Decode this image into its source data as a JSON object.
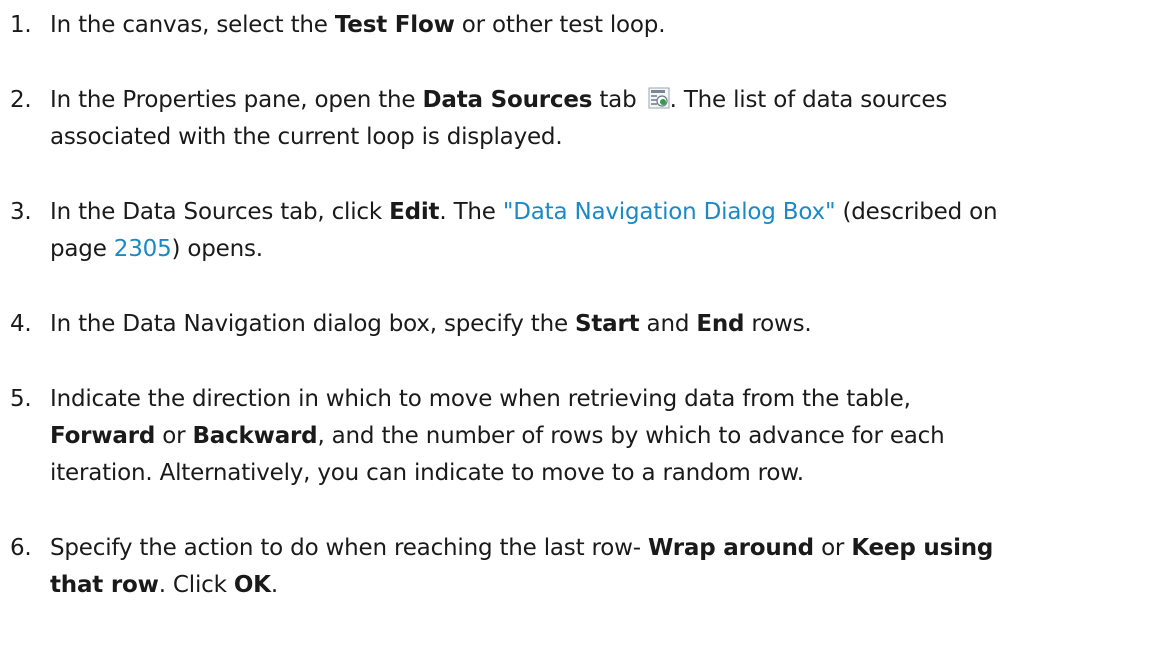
{
  "steps": [
    {
      "num": "1.",
      "parts": [
        {
          "t": "In the canvas, select the "
        },
        {
          "b": "Test Flow"
        },
        {
          "t": " or other test loop."
        }
      ]
    },
    {
      "num": "2.",
      "line1": [
        {
          "t": "In the Properties pane, open the "
        },
        {
          "b": "Data Sources"
        },
        {
          "t": " tab "
        },
        {
          "icon": "data-sources-tab-icon"
        },
        {
          "t": ". The list of data sources"
        }
      ],
      "line2": [
        {
          "t": "associated with the current loop is displayed."
        }
      ]
    },
    {
      "num": "3.",
      "line1": [
        {
          "t": "In the Data Sources tab, click "
        },
        {
          "b": "Edit"
        },
        {
          "t": ". The "
        },
        {
          "link": "\"Data Navigation Dialog Box\""
        },
        {
          "t": " (described on"
        }
      ],
      "line2": [
        {
          "t": "page "
        },
        {
          "link": "2305"
        },
        {
          "t": ") opens."
        }
      ]
    },
    {
      "num": "4.",
      "parts": [
        {
          "t": "In the Data Navigation dialog box, specify the "
        },
        {
          "b": "Start"
        },
        {
          "t": " and "
        },
        {
          "b": "End"
        },
        {
          "t": " rows."
        }
      ]
    },
    {
      "num": "5.",
      "line1": [
        {
          "t": "Indicate the direction in which to move when retrieving data from the table,"
        }
      ],
      "line2": [
        {
          "b": "Forward"
        },
        {
          "t": " or "
        },
        {
          "b": "Backward"
        },
        {
          "t": ", and the number of rows by which to advance for each"
        }
      ],
      "line3": [
        {
          "t": "iteration. Alternatively, you can indicate to move to a random row."
        }
      ]
    },
    {
      "num": "6.",
      "line1": [
        {
          "t": "Specify the action to do when reaching the last row- "
        },
        {
          "b": "Wrap around"
        },
        {
          "t": " or "
        },
        {
          "b": "Keep using"
        }
      ],
      "line2": [
        {
          "b": "that row"
        },
        {
          "t": ". Click "
        },
        {
          "b": "OK"
        },
        {
          "t": "."
        }
      ]
    }
  ],
  "colors": {
    "text": "#1a1a1a",
    "link": "#1a8ac6",
    "icon_accent": "#2f9e44"
  }
}
